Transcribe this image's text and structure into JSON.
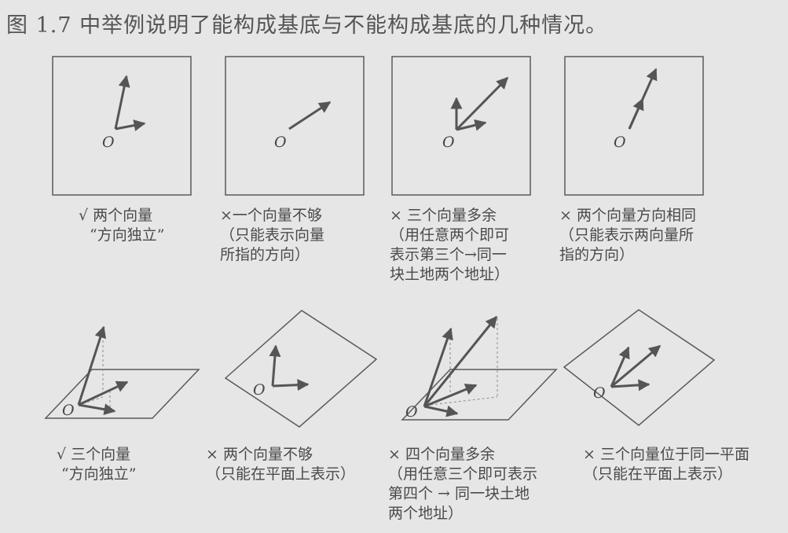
{
  "heading": "图 1.7 中举例说明了能构成基底与不能构成基底的几种情况。",
  "origin_label": "O",
  "colors": {
    "background": "#e6e6e6",
    "ink": "#555555",
    "frame": "#5a5a5a"
  },
  "panels_2d": [
    {
      "caption": [
        "√ 两个向量",
        "“方向独立”"
      ]
    },
    {
      "caption": [
        "×一个向量不够",
        "（只能表示向量",
        "所指的方向）"
      ]
    },
    {
      "caption": [
        "× 三个向量多余",
        "（用任意两个即可",
        "表示第三个→同一",
        "块土地两个地址）"
      ]
    },
    {
      "caption": [
        "× 两个向量方向相同",
        "（只能表示两向量所",
        "指的方向）"
      ]
    }
  ],
  "panels_3d": [
    {
      "caption": [
        "√ 三个向量",
        "“方向独立”"
      ]
    },
    {
      "caption": [
        "× 两个向量不够",
        "（只能在平面上表示）"
      ]
    },
    {
      "caption": [
        "× 四个向量多余",
        "（用任意三个即可表示",
        "第四个 → 同一块土地",
        "两个地址）"
      ]
    },
    {
      "caption": [
        "× 三个向量位于同一平面",
        "（只能在平面上表示）"
      ]
    }
  ]
}
